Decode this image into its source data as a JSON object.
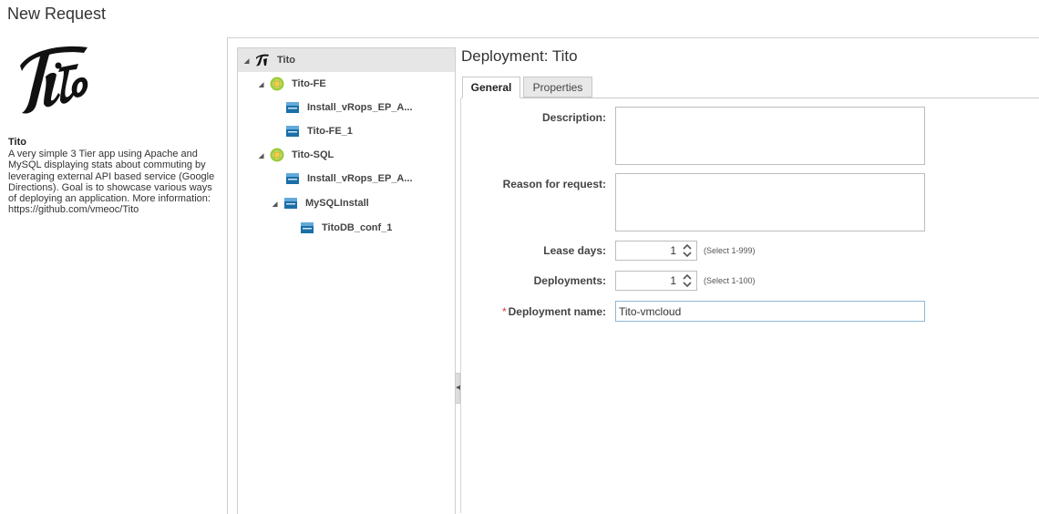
{
  "page": {
    "title": "New Request"
  },
  "blueprint": {
    "name": "Tito",
    "description": "A very simple 3 Tier app using Apache and MySQL displaying stats about commuting by leveraging external API based service (Google Directions). Goal is to showcase various ways of deploying an application. More information: https://github.com/vmeoc/Tito"
  },
  "tree": {
    "items": [
      {
        "label": "Tito",
        "icon": "tito-logo-icon"
      },
      {
        "label": "Tito-FE",
        "icon": "tier-group-icon"
      },
      {
        "label": "Install_vRops_EP_A...",
        "icon": "software-component-icon"
      },
      {
        "label": "Tito-FE_1",
        "icon": "software-component-icon"
      },
      {
        "label": "Tito-SQL",
        "icon": "tier-group-icon"
      },
      {
        "label": "Install_vRops_EP_A...",
        "icon": "software-component-icon"
      },
      {
        "label": "MySQLInstall",
        "icon": "software-component-icon"
      },
      {
        "label": "TitoDB_conf_1",
        "icon": "software-component-icon"
      }
    ]
  },
  "deployment": {
    "title": "Deployment: Tito",
    "tabs": [
      {
        "label": "General"
      },
      {
        "label": "Properties"
      }
    ],
    "form": {
      "description_label": "Description:",
      "description_value": "",
      "reason_label": "Reason for request:",
      "reason_value": "",
      "lease_label": "Lease days:",
      "lease_value": "1",
      "lease_hint": "(Select 1-999)",
      "deployments_label": "Deployments:",
      "deployments_value": "1",
      "deployments_hint": "(Select 1-100)",
      "required_mark": "*",
      "name_label": "Deployment name:",
      "name_value": "Tito-vmcloud"
    }
  },
  "colors": {
    "tier_icon": "#9ccc3c",
    "component_icon": "#1a6fa8",
    "required": "#dd3333"
  }
}
